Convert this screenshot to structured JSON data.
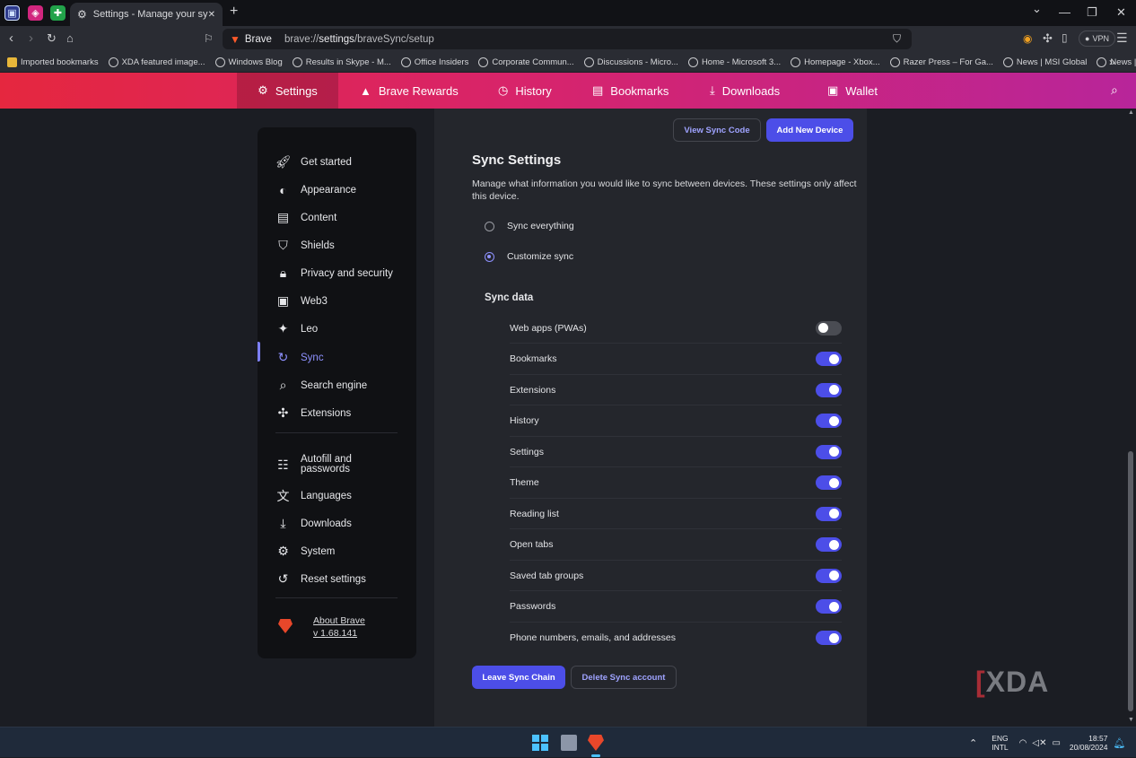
{
  "tab": {
    "title": "Settings - Manage your synced",
    "close": "✕",
    "new": "+"
  },
  "window": {
    "min": "—",
    "max": "❐",
    "close": "✕",
    "down": "⌄"
  },
  "omnibox": {
    "brand_name": "Brave",
    "url_prefix": "brave://",
    "url_bold": "settings",
    "url_suffix": "/braveSync/setup",
    "vpn": "VPN"
  },
  "bookmarks": [
    "Imported bookmarks",
    "XDA featured image...",
    "Windows Blog",
    "Results in Skype - M...",
    "Office Insiders",
    "Corporate Commun...",
    "Discussions - Micro...",
    "Home - Microsoft 3...",
    "Homepage - Xbox...",
    "Razer Press – For Ga...",
    "News | MSI Global",
    "News | MSI USA"
  ],
  "header_tabs": {
    "settings": "Settings",
    "rewards": "Brave Rewards",
    "history": "History",
    "bookmarks": "Bookmarks",
    "downloads": "Downloads",
    "wallet": "Wallet"
  },
  "sidebar": {
    "items": [
      "Get started",
      "Appearance",
      "Content",
      "Shields",
      "Privacy and security",
      "Web3",
      "Leo",
      "Sync",
      "Search engine",
      "Extensions",
      "Autofill and passwords",
      "Languages",
      "Downloads",
      "System",
      "Reset settings"
    ],
    "about": "About Brave",
    "version": "v 1.68.141"
  },
  "main": {
    "view_code": "View Sync Code",
    "add_device": "Add New Device",
    "title": "Sync Settings",
    "description": "Manage what information you would like to sync between devices. These settings only affect this device.",
    "radio_everything": "Sync everything",
    "radio_customize": "Customize sync",
    "sync_data_label": "Sync data",
    "data_items": [
      {
        "label": "Web apps (PWAs)",
        "on": false
      },
      {
        "label": "Bookmarks",
        "on": true
      },
      {
        "label": "Extensions",
        "on": true
      },
      {
        "label": "History",
        "on": true
      },
      {
        "label": "Settings",
        "on": true
      },
      {
        "label": "Theme",
        "on": true
      },
      {
        "label": "Reading list",
        "on": true
      },
      {
        "label": "Open tabs",
        "on": true
      },
      {
        "label": "Saved tab groups",
        "on": true
      },
      {
        "label": "Passwords",
        "on": true
      },
      {
        "label": "Phone numbers, emails, and addresses",
        "on": true
      }
    ],
    "leave_chain": "Leave Sync Chain",
    "delete_account": "Delete Sync account"
  },
  "watermark": "XDA",
  "tray": {
    "lang1": "ENG",
    "lang2": "INTL",
    "time": "18:57",
    "date": "20/08/2024"
  },
  "colors": {
    "accent": "#4c4ee8",
    "active_nav": "#8e91ff"
  }
}
